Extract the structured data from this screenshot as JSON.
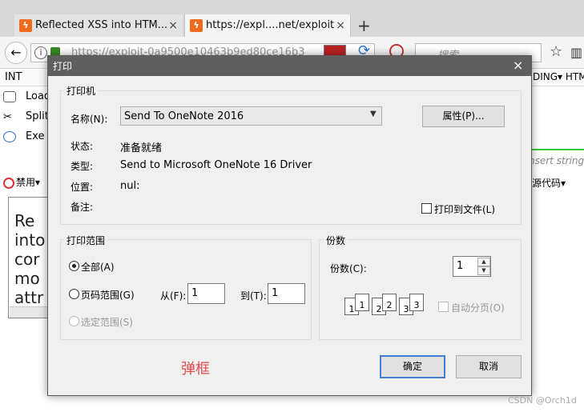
{
  "browser": {
    "tabs": [
      {
        "title": "Reflected XSS into HTM...",
        "active": false
      },
      {
        "title": "https://expl....net/exploit",
        "active": true
      }
    ],
    "new_tab": "+",
    "tab_close": "×",
    "url": "https://exploit-0a9500e10463b9ed80ce16b3",
    "search_placeholder": "搜索",
    "back_icon": "back-arrow-icon",
    "icons": [
      "info-icon",
      "lock-icon",
      "flag-icon",
      "reload-icon",
      "noscript-icon",
      "star-icon",
      "library-icon"
    ]
  },
  "hackbar": {
    "menu_left": "INT",
    "menu_right": "DING▾  HTM",
    "side_items": [
      "Load",
      "Split",
      "Exe"
    ],
    "insert_placeholder": "nsert string",
    "disable_label": "禁用▾",
    "source_label": "源代码▾",
    "preview_lines": [
      "Re",
      "into",
      "cor",
      "mo",
      "attr"
    ]
  },
  "dialog": {
    "title": "打印",
    "close": "×",
    "printer": {
      "group_label": "打印机",
      "name_label": "名称(N):",
      "name_value": "Send To OneNote 2016",
      "properties_button": "属性(P)...",
      "status_label": "状态:",
      "status_value": "准备就绪",
      "type_label": "类型:",
      "type_value": "Send to Microsoft OneNote 16 Driver",
      "where_label": "位置:",
      "where_value": "nul:",
      "comment_label": "备注:",
      "print_to_file_label": "打印到文件(L)",
      "print_to_file_checked": false
    },
    "range": {
      "group_label": "打印范围",
      "all_label": "全部(A)",
      "pages_label": "页码范围(G)",
      "from_label": "从(F):",
      "from_value": "1",
      "to_label": "到(T):",
      "to_value": "1",
      "selection_label": "选定范围(S)",
      "selected": "all"
    },
    "copies": {
      "group_label": "份数",
      "copies_label": "份数(C):",
      "copies_value": "1",
      "collate_label": "自动分页(O)",
      "collate_checked": false,
      "collate_pages": [
        "1",
        "1",
        "2",
        "2",
        "3",
        "3"
      ]
    },
    "ok_button": "确定",
    "cancel_button": "取消",
    "annotation": "弹框"
  },
  "watermark": "CSDN @Orch1d"
}
